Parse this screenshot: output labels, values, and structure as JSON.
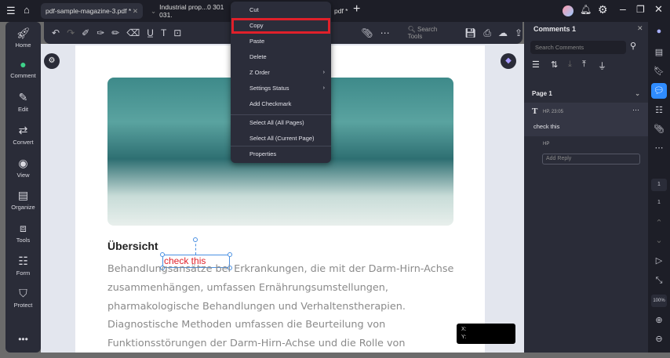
{
  "tabs": [
    {
      "label": "pdf-sample-magazine-3.pdf *"
    },
    {
      "label": "Industrial  prop...0 301 031."
    },
    {
      "label": "pdf *"
    }
  ],
  "sidebar": {
    "items": [
      {
        "label": "Home",
        "icon": "rocket-icon"
      },
      {
        "label": "Comment",
        "icon": "comment-icon"
      },
      {
        "label": "Edit",
        "icon": "edit-icon"
      },
      {
        "label": "Convert",
        "icon": "convert-icon"
      },
      {
        "label": "View",
        "icon": "eye-icon"
      },
      {
        "label": "Organize",
        "icon": "organize-icon"
      },
      {
        "label": "Tools",
        "icon": "toolbox-icon"
      },
      {
        "label": "Form",
        "icon": "form-icon"
      },
      {
        "label": "Protect",
        "icon": "shield-icon"
      }
    ]
  },
  "toolbar": {
    "search_placeholder": "Search Tools"
  },
  "context_menu": {
    "items": [
      "Cut",
      "Copy",
      "Paste",
      "Delete",
      "Z Order",
      "Settings Status",
      "Add Checkmark",
      "Select All (All Pages)",
      "Select All (Current Page)",
      "Properties"
    ],
    "highlighted": "Copy",
    "highlight_color": "#e0202a"
  },
  "document": {
    "heading": "Übersicht",
    "annotation": "check this",
    "lines": [
      "Behandlungsansätze bei Erkrankungen, die mit der Darm-Hirn-Achse",
      "zusammenhängen, umfassen Ernährungsumstellungen,",
      "pharmakologische Behandlungen und Verhaltenstherapien.",
      "Diagnostische Methoden umfassen die Beurteilung von",
      "Funktionsstörungen der Darm-Hirn-Achse und die Rolle von"
    ]
  },
  "coords": {
    "x_label": "X:",
    "y_label": "Y:"
  },
  "comments": {
    "title": "Comments 1",
    "search_placeholder": "Search Comments",
    "page_label": "Page 1",
    "author_time": "HP.  23:05",
    "text": "check this",
    "reply_author": "HP",
    "reply_placeholder": "Add Reply"
  },
  "rail": {
    "current_page": "1",
    "total_pages": "1",
    "zoom": "100%"
  }
}
